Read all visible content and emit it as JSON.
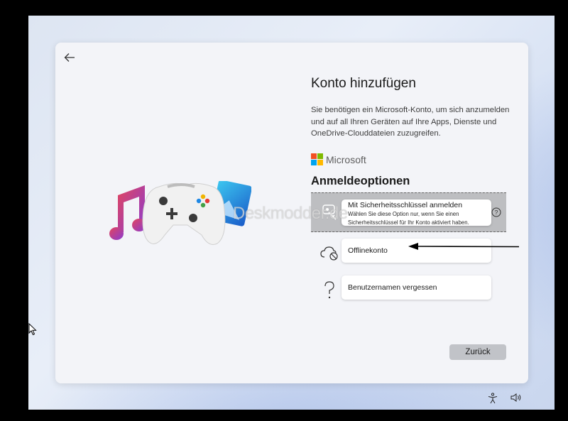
{
  "dialog": {
    "title": "Konto hinzufügen",
    "description": "Sie benötigen ein Microsoft-Konto, um sich anzumelden und auf all Ihren Geräten auf Ihre Apps, Dienste und OneDrive-Clouddateien zuzugreifen.",
    "brand": {
      "name": "Microsoft",
      "colors": [
        "#f25022",
        "#7fba00",
        "#00a4ef",
        "#ffb900"
      ]
    },
    "options_heading": "Anmeldeoptionen",
    "options": [
      {
        "id": "security-key",
        "icon": "security-key-icon",
        "title": "Mit Sicherheitsschlüssel anmelden",
        "subtitle": "Wählen Sie diese Option nur, wenn Sie einen Sicherheitsschlüssel für Ihr Konto aktiviert haben."
      },
      {
        "id": "offline",
        "icon": "cloud-offline-icon",
        "title": "Offlinekonto"
      },
      {
        "id": "forgot-username",
        "icon": "question-mark-icon",
        "title": "Benutzernamen vergessen"
      }
    ],
    "back_button_label": "Zurück"
  },
  "watermark": "Deskmodder.de",
  "colors": {
    "accent_arrow": "#000000",
    "button_bg": "#c1c3c8",
    "dialog_bg": "#f3f4f8"
  }
}
